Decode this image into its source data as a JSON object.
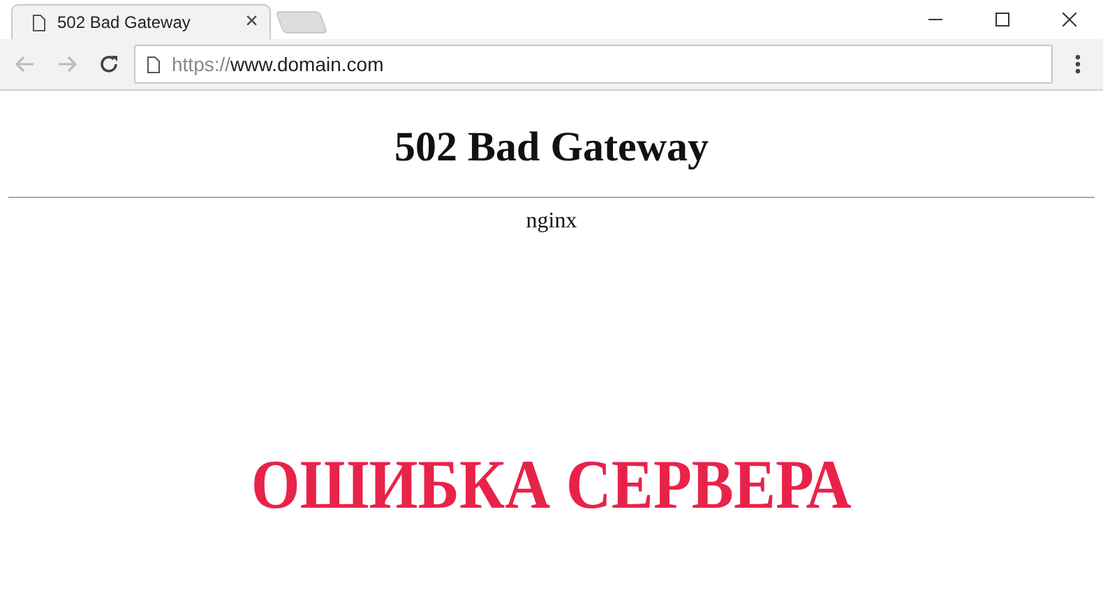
{
  "tabs": [
    {
      "title": "502 Bad Gateway",
      "close": "×",
      "selected": true
    }
  ],
  "address_bar": {
    "scheme": "https://",
    "host": "www.domain.com"
  },
  "page": {
    "heading": "502 Bad Gateway",
    "server": "nginx"
  },
  "caption": "ОШИБКА СЕРВЕРА"
}
